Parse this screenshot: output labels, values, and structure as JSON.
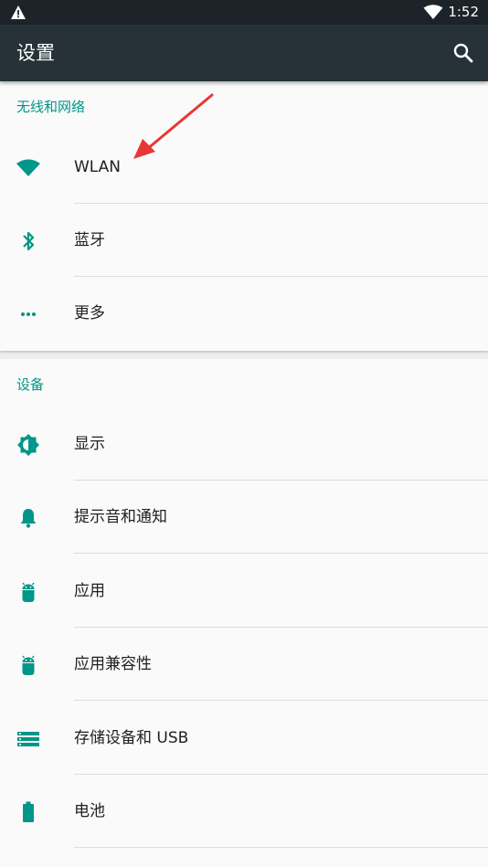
{
  "status_bar": {
    "time": "1:52",
    "icons": [
      "warning-icon",
      "wifi-icon"
    ]
  },
  "app_bar": {
    "title": "设置",
    "search_icon": "search-icon"
  },
  "sections": [
    {
      "header": "无线和网络",
      "items": [
        {
          "label": "WLAN",
          "icon": "wifi-icon"
        },
        {
          "label": "蓝牙",
          "icon": "bluetooth-icon"
        },
        {
          "label": "更多",
          "icon": "more-icon"
        }
      ]
    },
    {
      "header": "设备",
      "items": [
        {
          "label": "显示",
          "icon": "brightness-icon"
        },
        {
          "label": "提示音和通知",
          "icon": "bell-icon"
        },
        {
          "label": "应用",
          "icon": "android-icon"
        },
        {
          "label": "应用兼容性",
          "icon": "android-icon"
        },
        {
          "label": "存储设备和 USB",
          "icon": "storage-icon"
        },
        {
          "label": "电池",
          "icon": "battery-icon"
        }
      ]
    }
  ],
  "colors": {
    "status_bar": "#1c2429",
    "app_bar": "#263238",
    "accent": "#009688",
    "annotation_arrow": "#e53935"
  }
}
